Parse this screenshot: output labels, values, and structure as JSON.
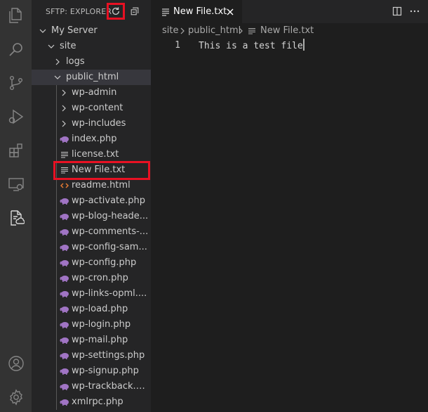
{
  "activity_bar": {
    "items": [
      {
        "icon": "explorer-icon"
      },
      {
        "icon": "search-icon"
      },
      {
        "icon": "source-control-icon"
      },
      {
        "icon": "run-debug-icon"
      },
      {
        "icon": "extensions-icon"
      },
      {
        "icon": "remote-explorer-icon"
      },
      {
        "icon": "sftp-icon"
      }
    ],
    "bottom": [
      {
        "icon": "account-icon"
      },
      {
        "icon": "settings-gear-icon"
      }
    ]
  },
  "sidebar": {
    "title": "SFTP: EXPLORER",
    "tree": [
      {
        "label": "My Server",
        "depth": 0,
        "type": "folder",
        "expanded": true
      },
      {
        "label": "site",
        "depth": 1,
        "type": "folder",
        "expanded": true
      },
      {
        "label": "logs",
        "depth": 2,
        "type": "folder",
        "expanded": false
      },
      {
        "label": "public_html",
        "depth": 2,
        "type": "folder",
        "expanded": true,
        "selected": true
      },
      {
        "label": "wp-admin",
        "depth": 3,
        "type": "folder",
        "expanded": false
      },
      {
        "label": "wp-content",
        "depth": 3,
        "type": "folder",
        "expanded": false
      },
      {
        "label": "wp-includes",
        "depth": 3,
        "type": "folder",
        "expanded": false
      },
      {
        "label": "index.php",
        "depth": 3,
        "type": "php"
      },
      {
        "label": "license.txt",
        "depth": 3,
        "type": "txt"
      },
      {
        "label": "New File.txt",
        "depth": 3,
        "type": "txt"
      },
      {
        "label": "readme.html",
        "depth": 3,
        "type": "html"
      },
      {
        "label": "wp-activate.php",
        "depth": 3,
        "type": "php"
      },
      {
        "label": "wp-blog-heade...",
        "depth": 3,
        "type": "php"
      },
      {
        "label": "wp-comments-...",
        "depth": 3,
        "type": "php"
      },
      {
        "label": "wp-config-sam...",
        "depth": 3,
        "type": "php"
      },
      {
        "label": "wp-config.php",
        "depth": 3,
        "type": "php"
      },
      {
        "label": "wp-cron.php",
        "depth": 3,
        "type": "php"
      },
      {
        "label": "wp-links-opml....",
        "depth": 3,
        "type": "php"
      },
      {
        "label": "wp-load.php",
        "depth": 3,
        "type": "php"
      },
      {
        "label": "wp-login.php",
        "depth": 3,
        "type": "php"
      },
      {
        "label": "wp-mail.php",
        "depth": 3,
        "type": "php"
      },
      {
        "label": "wp-settings.php",
        "depth": 3,
        "type": "php"
      },
      {
        "label": "wp-signup.php",
        "depth": 3,
        "type": "php"
      },
      {
        "label": "wp-trackback.p...",
        "depth": 3,
        "type": "php"
      },
      {
        "label": "xmlrpc.php",
        "depth": 3,
        "type": "php"
      }
    ]
  },
  "editor": {
    "tab": {
      "label": "New File.txt"
    },
    "breadcrumb": [
      "site",
      "public_html",
      "New File.txt"
    ],
    "lines": [
      {
        "number": "1",
        "text": "This is a test file"
      }
    ]
  },
  "colors": {
    "highlight": "#e81123",
    "php_icon": "#a074c4",
    "html_icon": "#e37933"
  }
}
